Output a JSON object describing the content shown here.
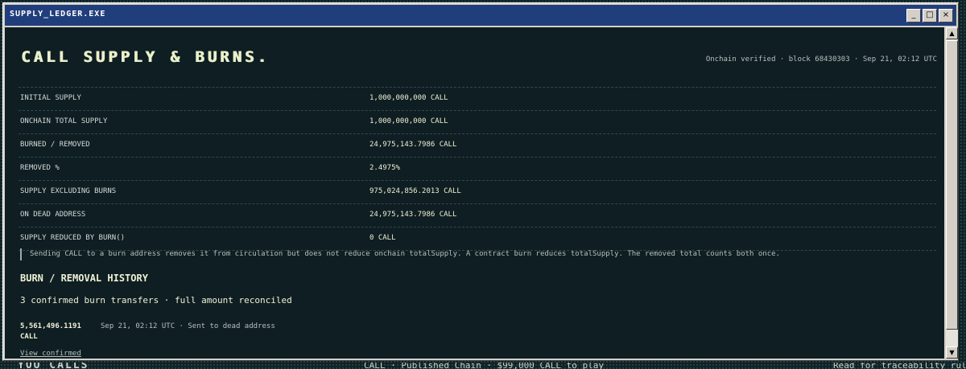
{
  "window": {
    "title": "SUPPLY_LEDGER.EXE",
    "minimize_label": "_",
    "maximize_label": "□",
    "close_label": "×"
  },
  "header": {
    "headline": "CALL SUPPLY & BURNS.",
    "verification": "Onchain verified · block 68430303 · Sep 21, 02:12 UTC"
  },
  "supply_table": {
    "rows": [
      {
        "label": "INITIAL SUPPLY",
        "value": "1,000,000,000 CALL"
      },
      {
        "label": "ONCHAIN TOTAL SUPPLY",
        "value": "1,000,000,000 CALL"
      },
      {
        "label": "BURNED / REMOVED",
        "value": "24,975,143.7986 CALL"
      },
      {
        "label": "REMOVED %",
        "value": "2.4975%"
      },
      {
        "label": "SUPPLY EXCLUDING BURNS",
        "value": "975,024,856.2013 CALL"
      },
      {
        "label": "ON DEAD ADDRESS",
        "value": "24,975,143.7986 CALL"
      },
      {
        "label": "SUPPLY REDUCED BY BURN()",
        "value": "0 CALL"
      }
    ]
  },
  "note": "Sending CALL to a burn address removes it from circulation but does not reduce onchain totalSupply. A contract burn reduces totalSupply. The removed total counts both once.",
  "history": {
    "title": "BURN / REMOVAL HISTORY",
    "summary": "3 confirmed burn transfers · full amount reconciled",
    "entries": [
      {
        "amount": "5,561,496.1191",
        "unit": "CALL",
        "meta": "Sep 21, 02:12 UTC · Sent to dead address"
      }
    ],
    "view_link": "View confirmed"
  },
  "desktop": {
    "left_text": "YOU CALLS",
    "mid_text": "CALL · Published Chain · $99,000 CALL to play",
    "right_text": "Read for traceability rules ↑"
  },
  "colors": {
    "titlebar": "#213e7c",
    "panel_bg": "#0f1e22",
    "text_primary": "#eef0d6",
    "text_muted": "#b5c0bd",
    "note_bar": "#8fb2a8"
  }
}
